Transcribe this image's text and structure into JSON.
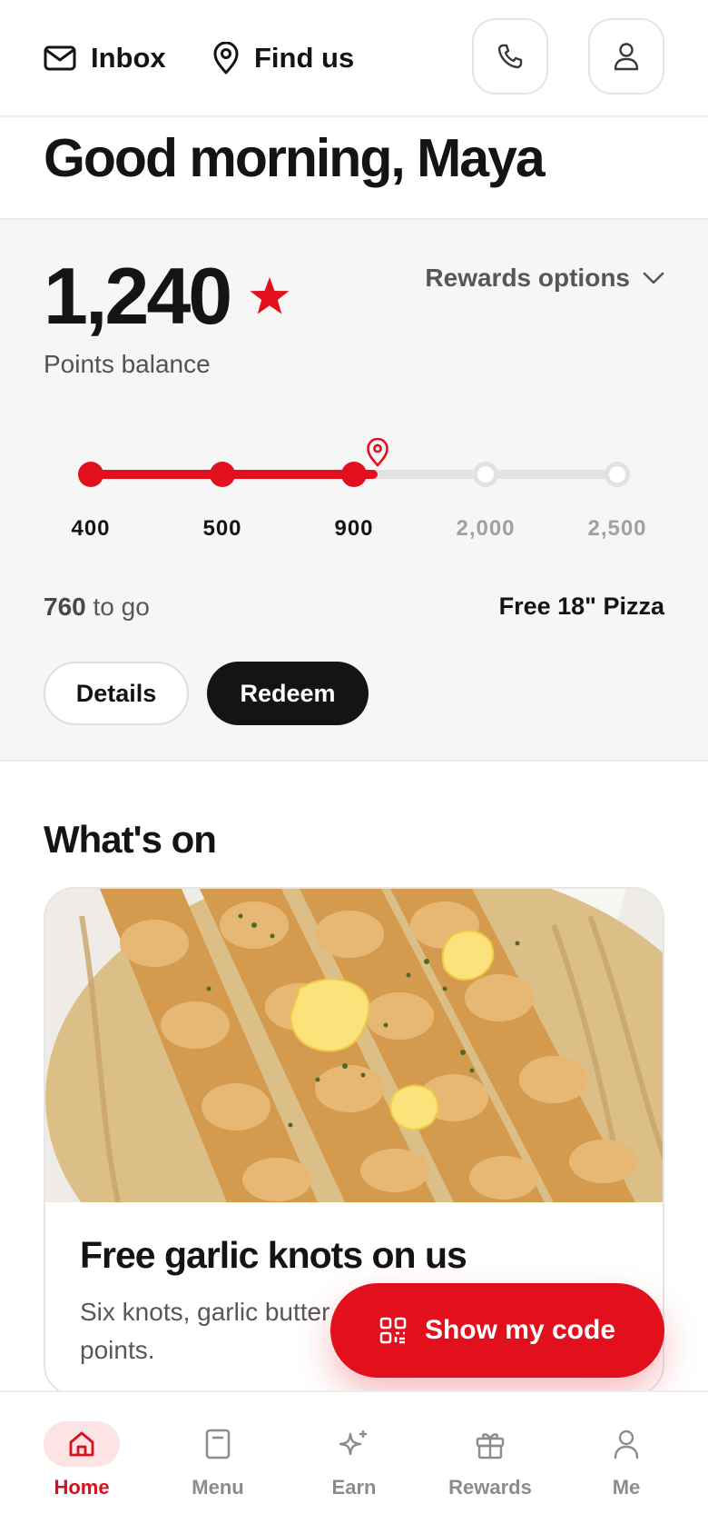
{
  "header": {
    "inbox_label": "Inbox",
    "find_us_label": "Find us",
    "phone_icon": "phone-icon",
    "profile_icon": "user-icon"
  },
  "greeting": "Good morning, Maya",
  "rewards": {
    "points": "1,240",
    "points_label": "Points balance",
    "options_label": "Rewards options",
    "progress_fraction": 0.545,
    "milestones": [
      {
        "label": "400",
        "reached": true
      },
      {
        "label": "500",
        "reached": true
      },
      {
        "label": "900",
        "reached": true
      },
      {
        "label": "2,000",
        "reached": false
      },
      {
        "label": "2,500",
        "reached": false
      }
    ],
    "to_go_value": "760",
    "to_go_suffix": " to go",
    "next_reward": "Free 18\" Pizza",
    "details_label": "Details",
    "redeem_label": "Redeem"
  },
  "whats_on": {
    "title": "What's on",
    "card": {
      "title": "Free garlic knots on us",
      "description": "Six knots, garlic butter and parmesan — for 300 points."
    }
  },
  "cta": {
    "label": "Show my code",
    "icon": "qr-code-icon"
  },
  "nav": [
    {
      "label": "Home",
      "icon": "home-icon",
      "active": true
    },
    {
      "label": "Menu",
      "icon": "menu-book-icon",
      "active": false
    },
    {
      "label": "Earn",
      "icon": "sparkle-icon",
      "active": false
    },
    {
      "label": "Rewards",
      "icon": "gift-icon",
      "active": false
    },
    {
      "label": "Me",
      "icon": "user-icon",
      "active": false
    }
  ],
  "colors": {
    "accent": "#e2101c",
    "dark": "#161412",
    "muted": "#5a5653",
    "panel": "#f6f6f6"
  }
}
